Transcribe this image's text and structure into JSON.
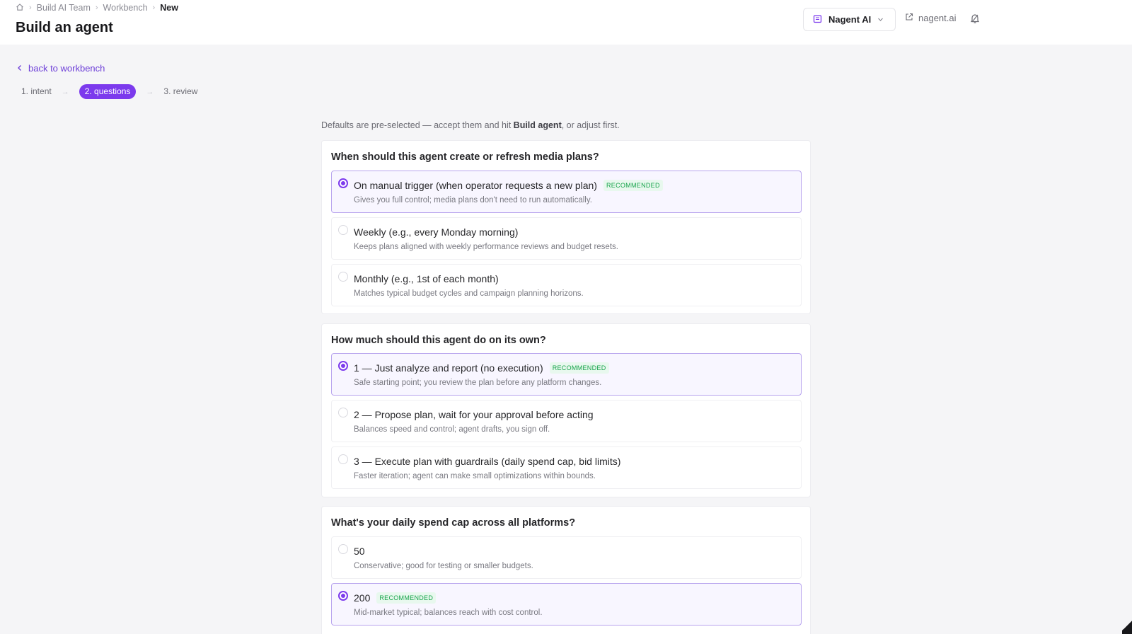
{
  "breadcrumb": {
    "team": "Build AI Team",
    "workbench": "Workbench",
    "current": "New"
  },
  "page": {
    "title": "Build an agent"
  },
  "org": {
    "name": "Nagent AI"
  },
  "external": {
    "label": "nagent.ai"
  },
  "nav": {
    "back_label": "back to workbench"
  },
  "steps": [
    "1. intent",
    "2. questions",
    "3. review"
  ],
  "intro": {
    "prefix": "Defaults are pre-selected — accept them and hit ",
    "action": "Build agent",
    "suffix": ", or adjust first."
  },
  "badge_label": "RECOMMENDED",
  "questions": [
    {
      "title": "When should this agent create or refresh media plans?",
      "options": [
        {
          "label": "On manual trigger (when operator requests a new plan)",
          "desc": "Gives you full control; media plans don't need to run automatically.",
          "selected": true,
          "recommended": true
        },
        {
          "label": "Weekly (e.g., every Monday morning)",
          "desc": "Keeps plans aligned with weekly performance reviews and budget resets.",
          "selected": false,
          "recommended": false
        },
        {
          "label": "Monthly (e.g., 1st of each month)",
          "desc": "Matches typical budget cycles and campaign planning horizons.",
          "selected": false,
          "recommended": false
        }
      ]
    },
    {
      "title": "How much should this agent do on its own?",
      "options": [
        {
          "label": "1 — Just analyze and report (no execution)",
          "desc": "Safe starting point; you review the plan before any platform changes.",
          "selected": true,
          "recommended": true
        },
        {
          "label": "2 — Propose plan, wait for your approval before acting",
          "desc": "Balances speed and control; agent drafts, you sign off.",
          "selected": false,
          "recommended": false
        },
        {
          "label": "3 — Execute plan with guardrails (daily spend cap, bid limits)",
          "desc": "Faster iteration; agent can make small optimizations within bounds.",
          "selected": false,
          "recommended": false
        }
      ]
    },
    {
      "title": "What's your daily spend cap across all platforms?",
      "options": [
        {
          "label": "50",
          "desc": "Conservative; good for testing or smaller budgets.",
          "selected": false,
          "recommended": false
        },
        {
          "label": "200",
          "desc": "Mid-market typical; balances reach with cost control.",
          "selected": true,
          "recommended": true
        }
      ]
    }
  ]
}
